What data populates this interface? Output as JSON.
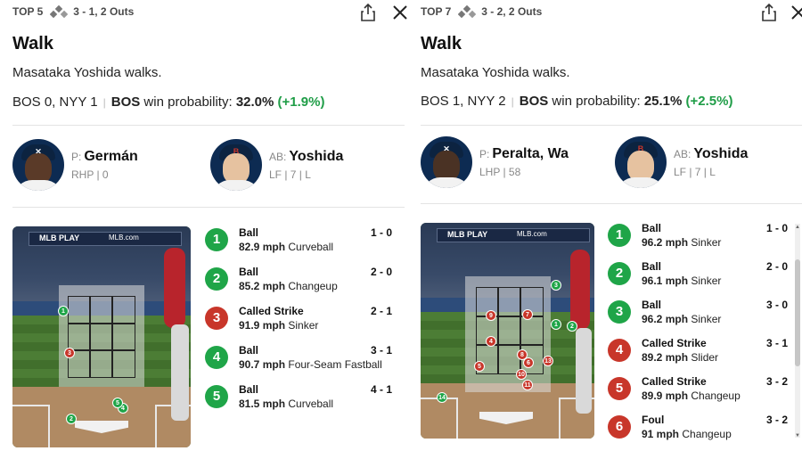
{
  "panels": [
    {
      "inning": "TOP 5",
      "count_outs": "3 - 1, 2 Outs",
      "title": "Walk",
      "description": "Masataka Yoshida walks.",
      "score": "BOS 0, NYY 1",
      "wp_team": "BOS",
      "wp_label": "win probability:",
      "wp_value": "32.0%",
      "wp_delta": "(+1.9%)",
      "pitcher": {
        "role": "P:",
        "name": "Germán",
        "meta": "RHP | 0"
      },
      "batter": {
        "role": "AB:",
        "name": "Yoshida",
        "meta": "LF | 7 | L"
      },
      "pitches": [
        {
          "n": "1",
          "result": "Ball",
          "speed": "82.9 mph",
          "type": "Curveball",
          "count": "1 - 0",
          "kind": "ball"
        },
        {
          "n": "2",
          "result": "Ball",
          "speed": "85.2 mph",
          "type": "Changeup",
          "count": "2 - 0",
          "kind": "ball"
        },
        {
          "n": "3",
          "result": "Called Strike",
          "speed": "91.9 mph",
          "type": "Sinker",
          "count": "2 - 1",
          "kind": "strike"
        },
        {
          "n": "4",
          "result": "Ball",
          "speed": "90.7 mph",
          "type": "Four-Seam Fastball",
          "count": "3 - 1",
          "kind": "ball"
        },
        {
          "n": "5",
          "result": "Ball",
          "speed": "81.5 mph",
          "type": "Curveball",
          "count": "4 - 1",
          "kind": "ball"
        }
      ]
    },
    {
      "inning": "TOP 7",
      "count_outs": "3 - 2, 2 Outs",
      "title": "Walk",
      "description": "Masataka Yoshida walks.",
      "score": "BOS 1, NYY 2",
      "wp_team": "BOS",
      "wp_label": "win probability:",
      "wp_value": "25.1%",
      "wp_delta": "(+2.5%)",
      "pitcher": {
        "role": "P:",
        "name": "Peralta, Wa",
        "meta": "LHP | 58"
      },
      "batter": {
        "role": "AB:",
        "name": "Yoshida",
        "meta": "LF | 7 | L"
      },
      "pitches": [
        {
          "n": "1",
          "result": "Ball",
          "speed": "96.2 mph",
          "type": "Sinker",
          "count": "1 - 0",
          "kind": "ball"
        },
        {
          "n": "2",
          "result": "Ball",
          "speed": "96.1 mph",
          "type": "Sinker",
          "count": "2 - 0",
          "kind": "ball"
        },
        {
          "n": "3",
          "result": "Ball",
          "speed": "96.2 mph",
          "type": "Sinker",
          "count": "3 - 0",
          "kind": "ball"
        },
        {
          "n": "4",
          "result": "Called Strike",
          "speed": "89.2 mph",
          "type": "Slider",
          "count": "3 - 1",
          "kind": "strike"
        },
        {
          "n": "5",
          "result": "Called Strike",
          "speed": "89.9 mph",
          "type": "Changeup",
          "count": "3 - 2",
          "kind": "strike"
        },
        {
          "n": "6",
          "result": "Foul",
          "speed": "91 mph",
          "type": "Changeup",
          "count": "3 - 2",
          "kind": "strike"
        }
      ]
    }
  ],
  "zone_board": {
    "logo": "MLB PLAY",
    "site": "MLB.com"
  },
  "zone_markers": {
    "a": [
      {
        "n": "1",
        "kind": "ball"
      },
      {
        "n": "2",
        "kind": "ball"
      },
      {
        "n": "3",
        "kind": "strike"
      },
      {
        "n": "4",
        "kind": "ball"
      },
      {
        "n": "5",
        "kind": "ball"
      }
    ],
    "b": [
      {
        "n": "3",
        "kind": "ball"
      },
      {
        "n": "9",
        "kind": "strike"
      },
      {
        "n": "7",
        "kind": "strike"
      },
      {
        "n": "1",
        "kind": "ball"
      },
      {
        "n": "2",
        "kind": "ball"
      },
      {
        "n": "4",
        "kind": "strike"
      },
      {
        "n": "8",
        "kind": "strike"
      },
      {
        "n": "5",
        "kind": "strike"
      },
      {
        "n": "6",
        "kind": "strike"
      },
      {
        "n": "13",
        "kind": "strike"
      },
      {
        "n": "10",
        "kind": "strike"
      },
      {
        "n": "11",
        "kind": "strike"
      },
      {
        "n": "14",
        "kind": "ball"
      }
    ]
  },
  "colors": {
    "ball": "#1fa548",
    "strike": "#c8362a",
    "wp_delta": "#1f9d47"
  },
  "icons": [
    "bases-icon",
    "share-icon",
    "close-icon"
  ]
}
